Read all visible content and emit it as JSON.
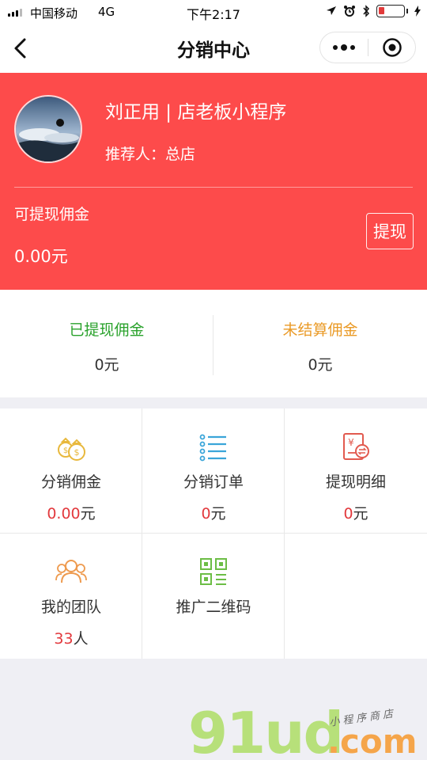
{
  "status_bar": {
    "carrier": "中国移动",
    "network": "4G",
    "time": "下午2:17"
  },
  "nav": {
    "title": "分销中心",
    "icons": [
      "back-chevron-icon",
      "more-dots-icon",
      "close-circle-icon"
    ]
  },
  "header": {
    "user_line": "刘正用 | 店老板小程序",
    "referrer": "推荐人：总店",
    "available_label": "可提现佣金",
    "available_value": "0.00元",
    "withdraw_button": "提现",
    "background_color": "#fd4b4b"
  },
  "stats": [
    {
      "label": "已提现佣金",
      "value": "0元",
      "color": "#2aa22c"
    },
    {
      "label": "未结算佣金",
      "value": "0元",
      "color": "#ea9a26"
    }
  ],
  "grid": [
    {
      "label": "分销佣金",
      "value_num": "0.00",
      "value_unit": "元",
      "icon": "money-bag-icon",
      "icon_color": "#e8b83c"
    },
    {
      "label": "分销订单",
      "value_num": "0",
      "value_unit": "元",
      "icon": "order-list-icon",
      "icon_color": "#3aa5d9"
    },
    {
      "label": "提现明细",
      "value_num": "0",
      "value_unit": "元",
      "icon": "withdraw-detail-icon",
      "icon_color": "#e25a4f"
    },
    {
      "label": "我的团队",
      "value_num": "33",
      "value_unit": "人",
      "icon": "team-icon",
      "icon_color": "#ee9a4e"
    },
    {
      "label": "推广二维码",
      "value_num": "",
      "value_unit": "",
      "icon": "qr-code-icon",
      "icon_color": "#6cbd45"
    }
  ],
  "watermark": {
    "main": "91ud",
    "domain": ".com",
    "tagline": "小程序商店"
  }
}
